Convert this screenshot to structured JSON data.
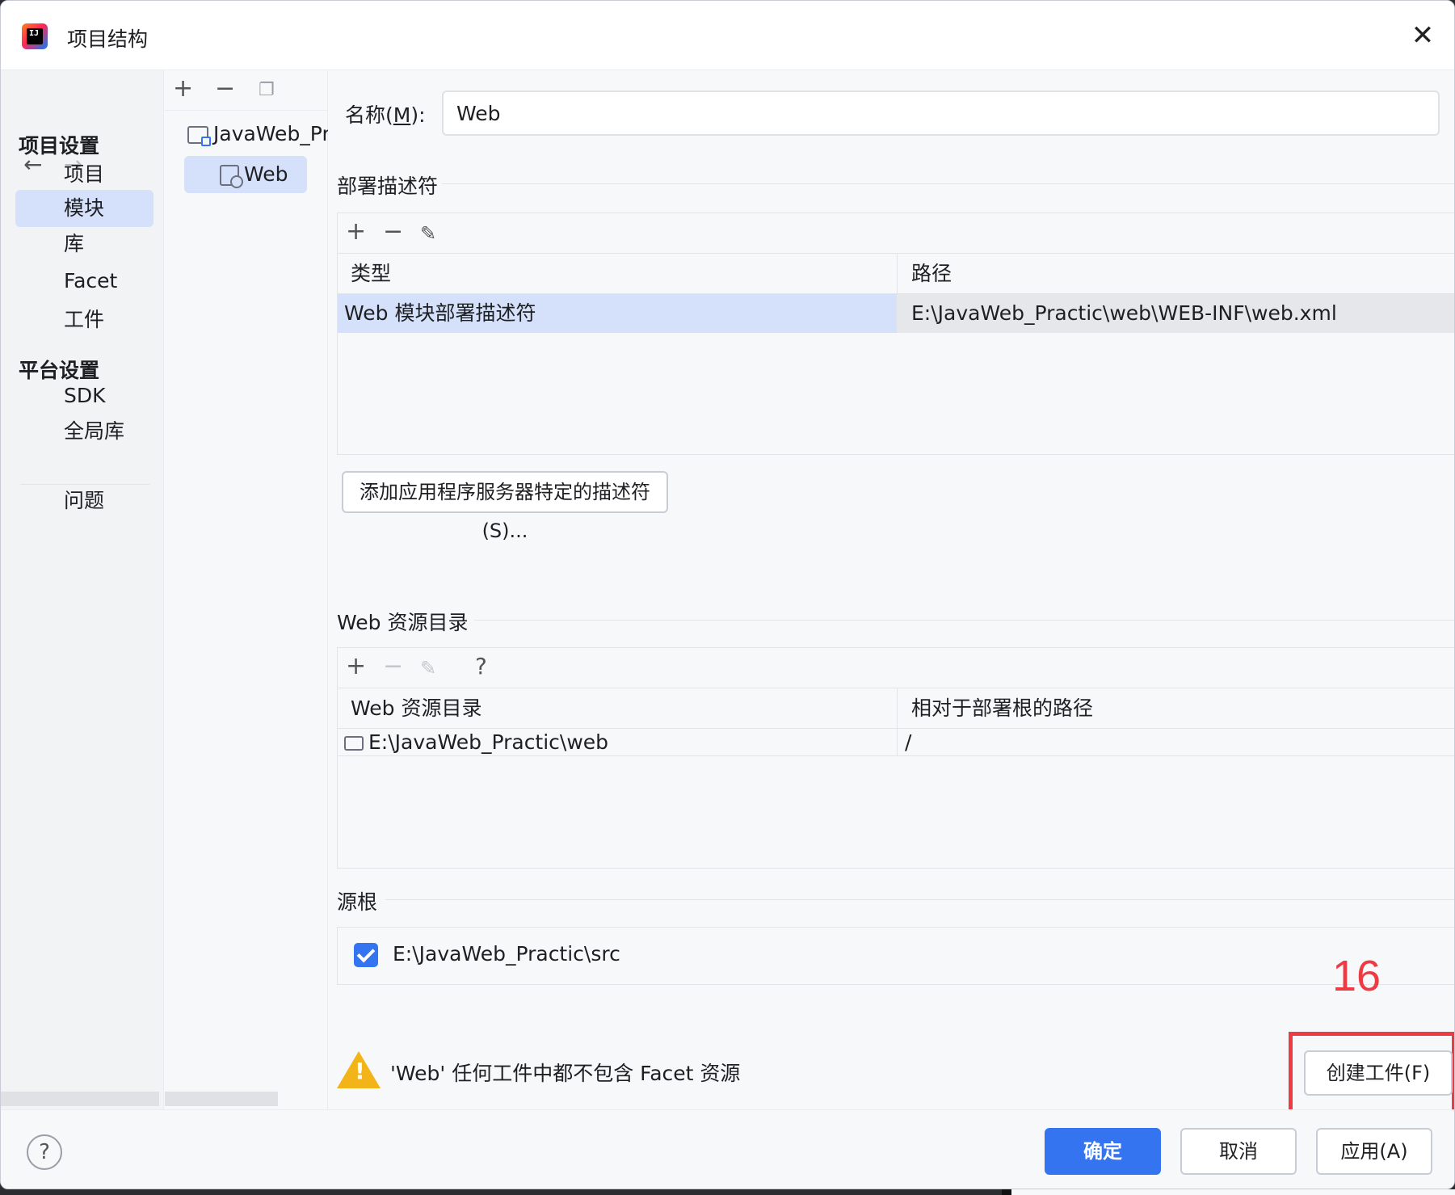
{
  "window": {
    "title": "项目结构"
  },
  "nav": {
    "project_settings_header": "项目设置",
    "items_project": [
      "项目",
      "模块",
      "库",
      "Facet",
      "工件"
    ],
    "platform_settings_header": "平台设置",
    "items_platform": [
      "SDK",
      "全局库"
    ],
    "problems": "问题",
    "selected": "模块"
  },
  "tree": {
    "root": "JavaWeb_Pr",
    "child": "Web"
  },
  "form": {
    "name_label": "名称(",
    "name_mnemonic": "M",
    "name_label_end": "):",
    "name_value": "Web"
  },
  "deploy": {
    "section_title": "部署描述符",
    "col_type": "类型",
    "col_path": "路径",
    "row_type": "Web 模块部署描述符",
    "row_path": "E:\\JavaWeb_Practic\\web\\WEB-INF\\web.xml",
    "add_button": "添加应用程序服务器特定的描述符(S)..."
  },
  "web_resources": {
    "section_title": "Web 资源目录",
    "col_dir": "Web 资源目录",
    "col_rel": "相对于部署根的路径",
    "row_dir": "E:\\JavaWeb_Practic\\web",
    "row_rel": "/",
    "help_glyph": "?"
  },
  "source_roots": {
    "section_title": "源根",
    "item": "E:\\JavaWeb_Practic\\src",
    "checked": true
  },
  "warning": {
    "text": "'Web' 任何工件中都不包含 Facet 资源",
    "create_button": "创建工件(F)"
  },
  "annotation": {
    "number": "16",
    "color": "#ee3a42"
  },
  "footer": {
    "ok": "确定",
    "cancel": "取消",
    "apply": "应用(A)",
    "help": "?"
  },
  "colors": {
    "accent": "#3574f0",
    "selection": "#d5e1fb",
    "warning": "#f2b418"
  }
}
